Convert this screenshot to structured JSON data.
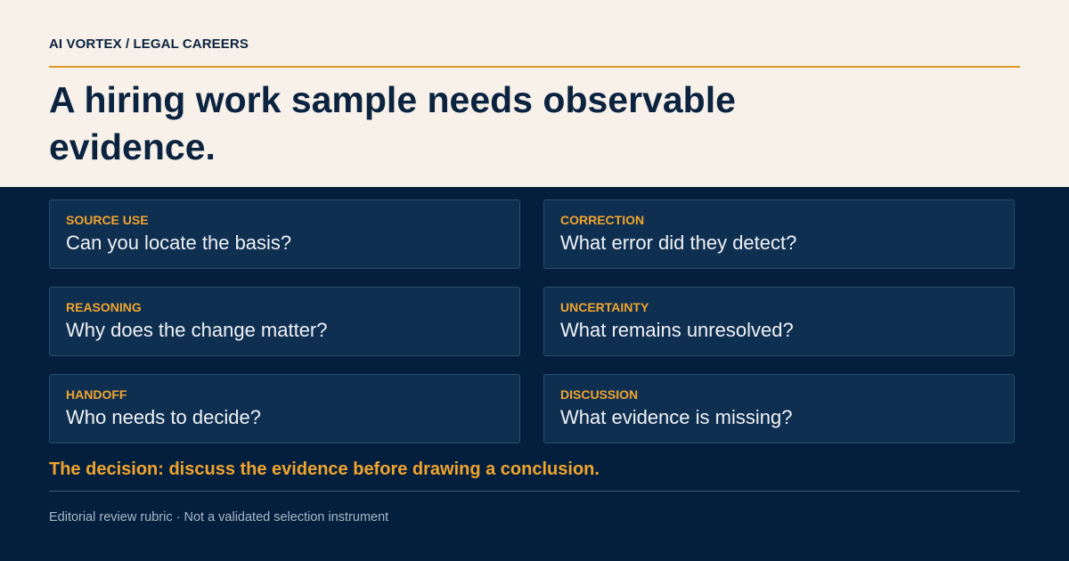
{
  "header": {
    "kicker": "AI VORTEX / LEGAL CAREERS",
    "headline": "A hiring work sample needs observable evidence."
  },
  "cards": [
    {
      "label": "SOURCE USE",
      "question": "Can you locate the basis?"
    },
    {
      "label": "CORRECTION",
      "question": "What error did they detect?"
    },
    {
      "label": "REASONING",
      "question": "Why does the change matter?"
    },
    {
      "label": "UNCERTAINTY",
      "question": "What remains unresolved?"
    },
    {
      "label": "HANDOFF",
      "question": "Who needs to decide?"
    },
    {
      "label": "DISCUSSION",
      "question": "What evidence is missing?"
    }
  ],
  "decision": "The decision: discuss the evidence before drawing a conclusion.",
  "footnote": "Editorial review rubric · Not a validated selection instrument",
  "colors": {
    "navy": "#041f3d",
    "cream": "#f7f1ea",
    "accent": "#f0a42e",
    "card": "#0f2f50"
  }
}
